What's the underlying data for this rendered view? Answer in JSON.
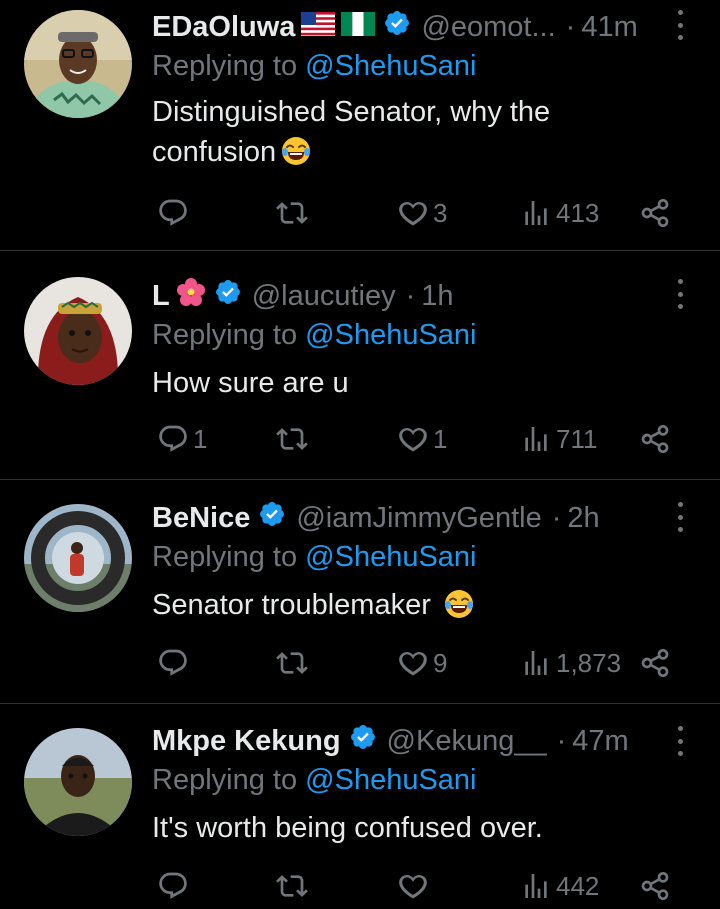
{
  "tweets": [
    {
      "name": "EDaOluwa",
      "flags": [
        "us-flag-icon",
        "ng-flag-icon"
      ],
      "handle": "@eomot...",
      "time": "41m",
      "replying_prefix": "Replying to ",
      "replying_to": "@ShehuSani",
      "text": "Distinguished Senator, why the confusion",
      "emoji": "face-with-tears-of-joy",
      "replies": "",
      "retweets": "",
      "likes": "3",
      "views": "413"
    },
    {
      "name": "L",
      "flags": [
        "hibiscus-emoji-icon"
      ],
      "handle": "@laucutiey",
      "time": "1h",
      "replying_prefix": "Replying to ",
      "replying_to": "@ShehuSani",
      "text": "How sure are u",
      "emoji": "",
      "replies": "1",
      "retweets": "",
      "likes": "1",
      "views": "711"
    },
    {
      "name": "BeNice",
      "flags": [],
      "handle": "@iamJimmyGentle",
      "time": "2h",
      "replying_prefix": "Replying to ",
      "replying_to": "@ShehuSani",
      "text": "Senator troublemaker ",
      "emoji": "face-with-tears-of-joy",
      "replies": "",
      "retweets": "",
      "likes": "9",
      "views": "1,873"
    },
    {
      "name": "Mkpe Kekung",
      "flags": [],
      "handle": "@Kekung__",
      "time": "47m",
      "replying_prefix": "Replying to ",
      "replying_to": "@ShehuSani",
      "text": "It's worth being confused over.",
      "emoji": "",
      "replies": "",
      "retweets": "",
      "likes": "",
      "views": "442"
    }
  ],
  "separator": "·",
  "colors": {
    "background": "#000000",
    "text": "#e7e9ea",
    "muted": "#71767b",
    "link": "#1d9bf0",
    "verified": "#1d9bf0",
    "divider": "#2f3336"
  },
  "icons": [
    "reply-icon",
    "retweet-icon",
    "like-icon",
    "views-icon",
    "share-icon",
    "more-icon",
    "verified-badge-icon"
  ]
}
